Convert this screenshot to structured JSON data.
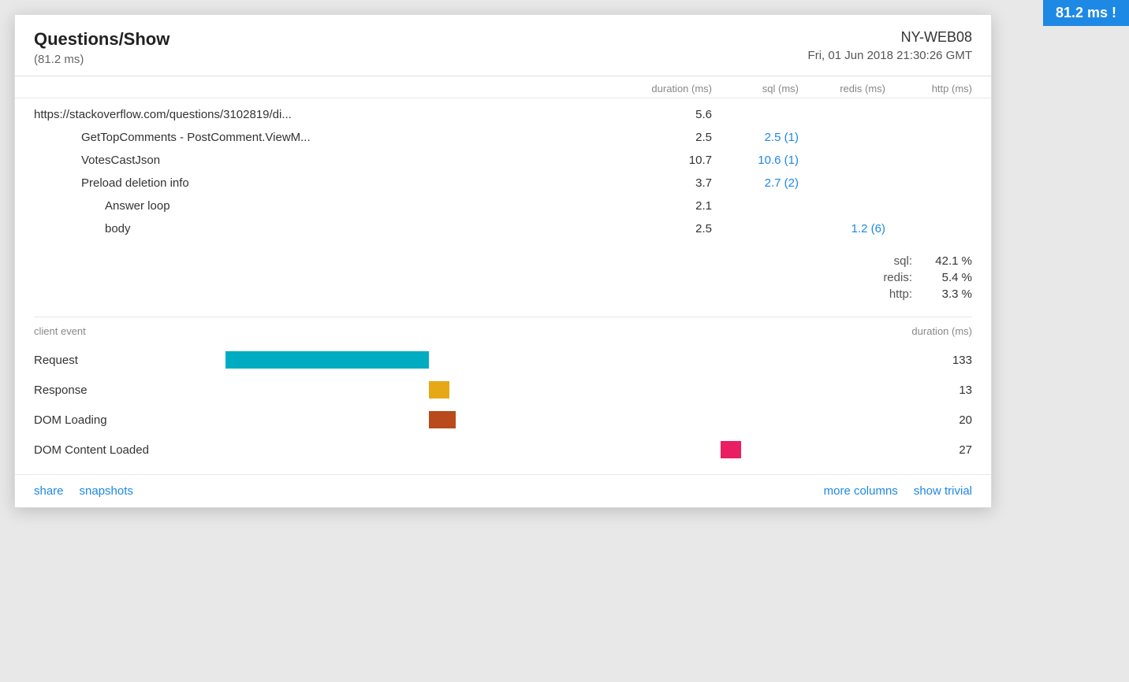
{
  "topbar": {
    "badge": "81.2 ms !"
  },
  "panel": {
    "title": "Questions/Show",
    "subtitle": "(81.2 ms)",
    "server": "NY-WEB08",
    "datetime": "Fri, 01 Jun 2018 21:30:26 GMT"
  },
  "columns": {
    "name": "",
    "duration": "duration (ms)",
    "sql": "sql (ms)",
    "redis": "redis (ms)",
    "http": "http (ms)"
  },
  "rows": [
    {
      "name": "https://stackoverflow.com/questions/3102819/di...",
      "indent": 0,
      "duration": "5.6",
      "sql": "",
      "redis": "",
      "http": ""
    },
    {
      "name": "GetTopComments - PostComment.ViewM...",
      "indent": 1,
      "duration": "2.5",
      "sql": "2.5 (1)",
      "redis": "",
      "http": ""
    },
    {
      "name": "VotesCastJson",
      "indent": 1,
      "duration": "10.7",
      "sql": "10.6 (1)",
      "redis": "",
      "http": ""
    },
    {
      "name": "Preload deletion info",
      "indent": 1,
      "duration": "3.7",
      "sql": "2.7 (2)",
      "redis": "",
      "http": ""
    },
    {
      "name": "Answer loop",
      "indent": 2,
      "duration": "2.1",
      "sql": "",
      "redis": "",
      "http": ""
    },
    {
      "name": "body",
      "indent": 2,
      "duration": "2.5",
      "sql": "",
      "redis": "1.2 (6)",
      "http": ""
    }
  ],
  "percentages": [
    {
      "label": "sql:",
      "value": "42.1 %"
    },
    {
      "label": "redis:",
      "value": "5.4 %"
    },
    {
      "label": "http:",
      "value": "3.3 %"
    }
  ],
  "client_events": {
    "header_event": "client event",
    "header_duration": "duration (ms)",
    "events": [
      {
        "name": "Request",
        "duration": "133",
        "bar_color": "#00acc1",
        "bar_left_pct": 5,
        "bar_width_pct": 30
      },
      {
        "name": "Response",
        "duration": "13",
        "bar_color": "#e6a817",
        "bar_left_pct": 35,
        "bar_width_pct": 3
      },
      {
        "name": "DOM Loading",
        "duration": "20",
        "bar_color": "#b84a1c",
        "bar_left_pct": 35,
        "bar_width_pct": 4
      },
      {
        "name": "DOM Content Loaded",
        "duration": "27",
        "bar_color": "#e91e63",
        "bar_left_pct": 78,
        "bar_width_pct": 3
      }
    ]
  },
  "footer": {
    "share": "share",
    "snapshots": "snapshots",
    "more_columns": "more columns",
    "show_trivial": "show trivial"
  }
}
